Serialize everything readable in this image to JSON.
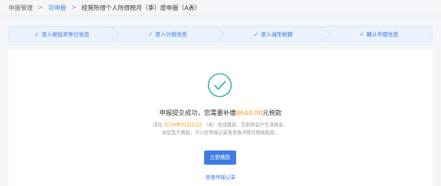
{
  "breadcrumb": {
    "items": [
      "申报管理",
      "可申报",
      "经营所得个人所得税月（季）度申报（A表）"
    ],
    "separator": ">"
  },
  "steps": [
    {
      "label": "录入被投资单位信息",
      "status": "done"
    },
    {
      "label": "录入计税信息",
      "status": "done"
    },
    {
      "label": "录入减免税额",
      "status": "done"
    },
    {
      "label": "确认申报信息",
      "status": "done"
    }
  ],
  "step_check_glyph": "✓",
  "result": {
    "icon": "check-circle-icon",
    "title_prefix": "申报提交成功，您需要补缴",
    "amount": "8640.00",
    "title_suffix": "元税款",
    "sub_line1_prefix": "请在",
    "deadline": "2019年02月22日",
    "sub_line1_suffix": "（含）完成缴款，否则将会产生滞纳金，",
    "sub_line2": "如您暂不缴款，可以在申报记录里查看详情并缴纳税款。"
  },
  "actions": {
    "pay_label": "立即缴款",
    "view_records_label": "查看申报记录"
  },
  "colors": {
    "accent": "#3b7ae0",
    "success": "#2fb39a",
    "highlight": "#f39a1f"
  }
}
